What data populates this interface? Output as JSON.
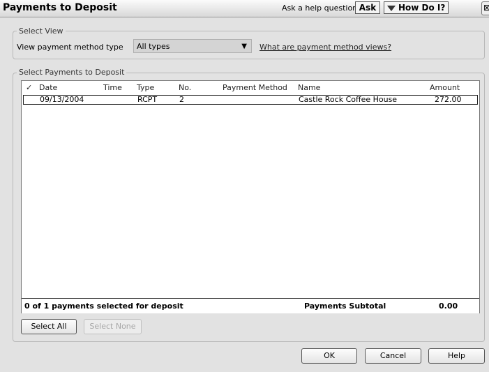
{
  "window": {
    "title": "Payments to Deposit"
  },
  "help": {
    "label": "Ask a help question",
    "ask_button": "Ask",
    "how_do_i_button": "How Do I?",
    "close_glyph": "⊠"
  },
  "select_view": {
    "legend": "Select View",
    "label": "View payment method type",
    "selected": "All types",
    "link": "What are payment method views?"
  },
  "payments": {
    "legend": "Select Payments to Deposit",
    "columns": {
      "check": "✓",
      "date": "Date",
      "time": "Time",
      "type": "Type",
      "no": "No.",
      "method": "Payment Method",
      "name": "Name",
      "amount": "Amount"
    },
    "rows": [
      {
        "date": "09/13/2004",
        "time": "",
        "type": "RCPT",
        "no": "2",
        "method": "",
        "name": "Castle Rock Coffee House",
        "amount": "272.00"
      }
    ],
    "selected_text": "0 of 1 payments selected for deposit",
    "subtotal_label": "Payments Subtotal",
    "subtotal_value": "0.00"
  },
  "buttons": {
    "select_all": "Select All",
    "select_none": "Select None",
    "ok": "OK",
    "cancel": "Cancel",
    "help": "Help"
  }
}
